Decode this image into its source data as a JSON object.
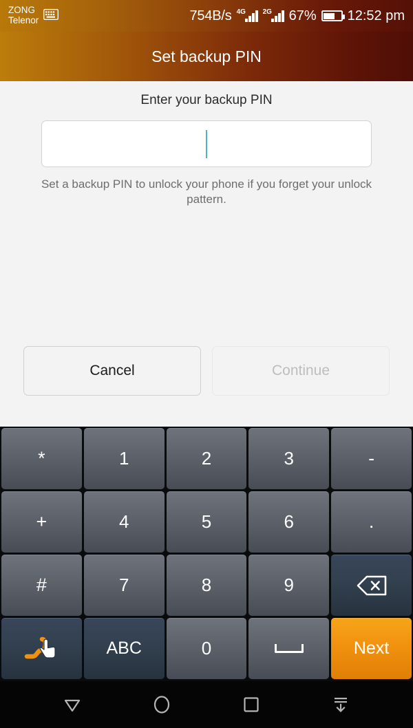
{
  "status_bar": {
    "carrier_1": "ZONG",
    "carrier_2": "Telenor",
    "keyboard_indicator_icon": "keyboard-icon",
    "network_speed": "754B/s",
    "sim1_network": "4G",
    "sim2_network": "2G",
    "battery_percent": "67%",
    "battery_level": 67,
    "time": "12:52 pm"
  },
  "header": {
    "title": "Set backup PIN"
  },
  "main": {
    "field_label": "Enter your backup PIN",
    "pin_value": "",
    "pin_placeholder": "",
    "hint": "Set a backup PIN to unlock your phone if you forget your unlock pattern.",
    "cancel_label": "Cancel",
    "continue_label": "Continue",
    "continue_enabled": false,
    "caret_color": "#4fb3c4"
  },
  "keyboard": {
    "accent_color": "#f1920f",
    "rows": [
      [
        {
          "label": "*",
          "name": "key-asterisk",
          "style": "sym"
        },
        {
          "label": "1",
          "name": "key-1",
          "style": "num"
        },
        {
          "label": "2",
          "name": "key-2",
          "style": "num"
        },
        {
          "label": "3",
          "name": "key-3",
          "style": "num"
        },
        {
          "label": "-",
          "name": "key-hyphen",
          "style": "sym"
        }
      ],
      [
        {
          "label": "+",
          "name": "key-plus",
          "style": "sym"
        },
        {
          "label": "4",
          "name": "key-4",
          "style": "num"
        },
        {
          "label": "5",
          "name": "key-5",
          "style": "num"
        },
        {
          "label": "6",
          "name": "key-6",
          "style": "num"
        },
        {
          "label": ".",
          "name": "key-period",
          "style": "sym"
        }
      ],
      [
        {
          "label": "#",
          "name": "key-hash",
          "style": "sym"
        },
        {
          "label": "7",
          "name": "key-7",
          "style": "num"
        },
        {
          "label": "8",
          "name": "key-8",
          "style": "num"
        },
        {
          "label": "9",
          "name": "key-9",
          "style": "num"
        },
        {
          "label": "",
          "name": "key-backspace",
          "style": "fn",
          "icon": "backspace-icon"
        }
      ],
      [
        {
          "label": "",
          "name": "key-swipe-input",
          "style": "fn",
          "icon": "swipe-gesture-icon"
        },
        {
          "label": "ABC",
          "name": "key-abc",
          "style": "fn"
        },
        {
          "label": "0",
          "name": "key-0",
          "style": "num"
        },
        {
          "label": "",
          "name": "key-space",
          "style": "num",
          "icon": "spacebar-icon"
        },
        {
          "label": "Next",
          "name": "key-next",
          "style": "accent"
        }
      ]
    ]
  },
  "navbar": {
    "items": [
      {
        "name": "nav-back-button",
        "icon": "back-triangle-icon"
      },
      {
        "name": "nav-home-button",
        "icon": "home-circle-icon"
      },
      {
        "name": "nav-recents-button",
        "icon": "recents-square-icon"
      },
      {
        "name": "nav-hide-keyboard-button",
        "icon": "hide-keyboard-icon"
      }
    ]
  }
}
